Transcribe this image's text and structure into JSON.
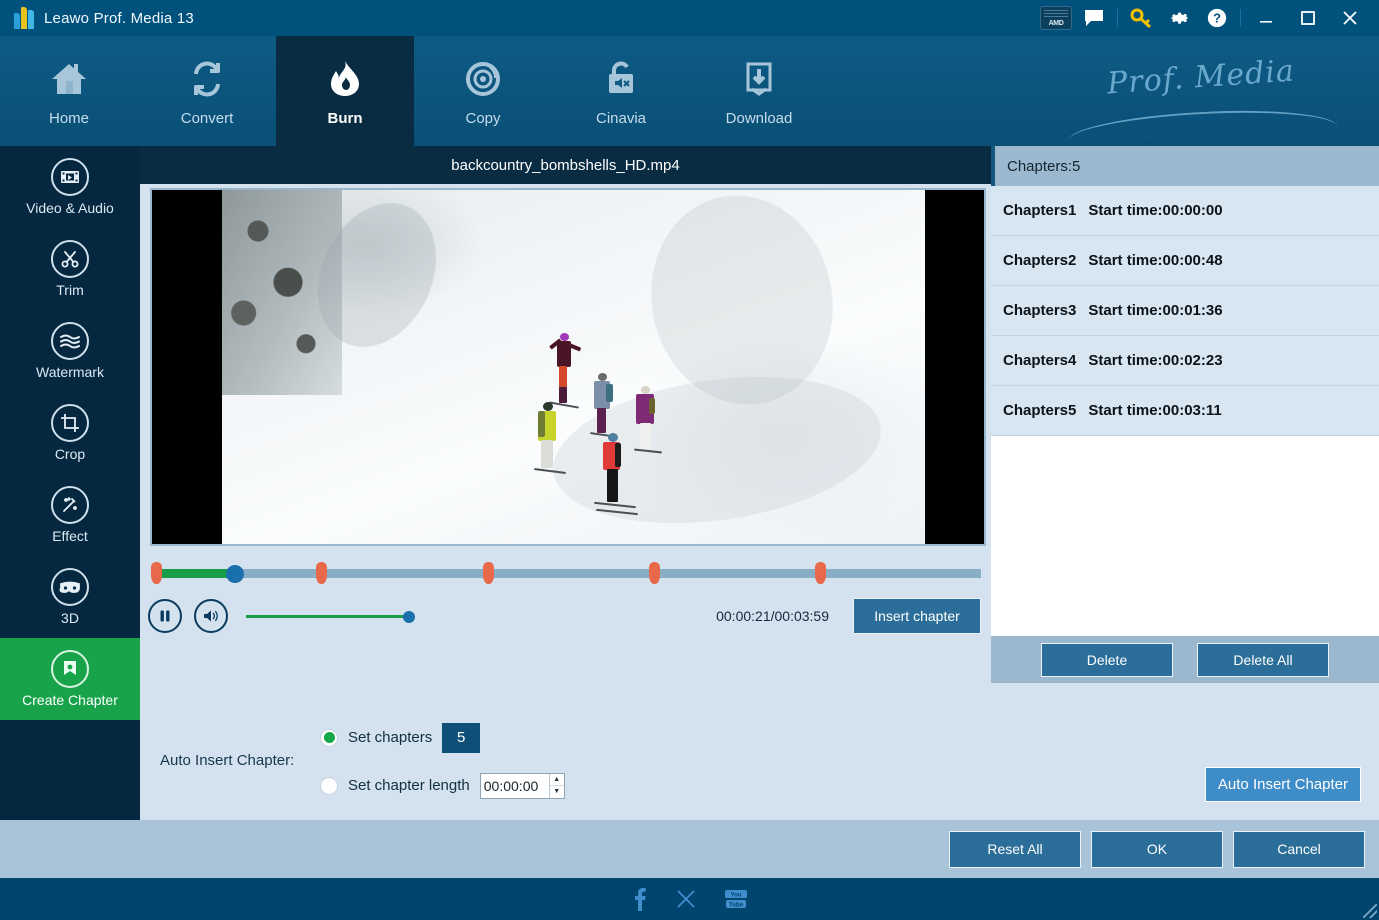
{
  "window": {
    "title": "Leawo Prof. Media 13",
    "icons": {
      "amd": "AMD",
      "feedback": "feedback-icon",
      "key": "key-icon",
      "settings": "gear-icon",
      "help": "help-icon",
      "minimize": "minimize-icon",
      "maximize": "maximize-icon",
      "close": "close-icon"
    }
  },
  "nav": {
    "items": [
      {
        "label": "Home",
        "icon": "home-icon",
        "active": false
      },
      {
        "label": "Convert",
        "icon": "convert-icon",
        "active": false
      },
      {
        "label": "Burn",
        "icon": "flame-icon",
        "active": true
      },
      {
        "label": "Copy",
        "icon": "disc-icon",
        "active": false
      },
      {
        "label": "Cinavia",
        "icon": "mute-lock-icon",
        "active": false
      },
      {
        "label": "Download",
        "icon": "download-icon",
        "active": false
      }
    ],
    "brand": "Prof. Media"
  },
  "sidebar": {
    "items": [
      {
        "label": "Video & Audio",
        "icon": "film-icon",
        "active": false
      },
      {
        "label": "Trim",
        "icon": "scissors-icon",
        "active": false
      },
      {
        "label": "Watermark",
        "icon": "waves-icon",
        "active": false
      },
      {
        "label": "Crop",
        "icon": "crop-icon",
        "active": false
      },
      {
        "label": "Effect",
        "icon": "magic-wand-icon",
        "active": false
      },
      {
        "label": "3D",
        "icon": "glasses-icon",
        "active": false
      },
      {
        "label": "Create Chapter",
        "icon": "chapter-icon",
        "active": true
      }
    ]
  },
  "preview": {
    "file_name": "backcountry_bombshells_HD.mp4"
  },
  "player": {
    "current_time": "00:00:21",
    "total_time": "00:03:59",
    "time_display": "00:00:21/00:03:59",
    "progress_percent": 8.8,
    "volume_percent": 94,
    "play_state": "pause-icon",
    "volume_icon": "volume-on-icon",
    "insert_chapter_label": "Insert chapter",
    "markers_percent": [
      0.5,
      20.0,
      40.2,
      60.3,
      80.4
    ]
  },
  "auto_insert": {
    "section_label": "Auto Insert Chapter:",
    "set_chapters_label": "Set chapters",
    "set_chapters_value": "5",
    "set_chapters_selected": true,
    "set_length_label": "Set chapter length",
    "set_length_value": "00:00:00",
    "set_length_selected": false,
    "button_label": "Auto Insert Chapter"
  },
  "chapters_panel": {
    "header": "Chapters:5",
    "columns": [
      "Chapter",
      "Start time"
    ],
    "rows": [
      {
        "name": "Chapters1",
        "time": "Start time:00:00:00"
      },
      {
        "name": "Chapters2",
        "time": "Start time:00:00:48"
      },
      {
        "name": "Chapters3",
        "time": "Start time:00:01:36"
      },
      {
        "name": "Chapters4",
        "time": "Start time:00:02:23"
      },
      {
        "name": "Chapters5",
        "time": "Start time:00:03:11"
      }
    ],
    "delete_label": "Delete",
    "delete_all_label": "Delete All"
  },
  "bottom_bar": {
    "reset_all": "Reset All",
    "ok": "OK",
    "cancel": "Cancel"
  },
  "footer": {
    "socials": [
      "facebook-icon",
      "x-icon",
      "youtube-icon"
    ]
  },
  "colors": {
    "accent_green": "#18a34a",
    "accent_blue": "#2a6e99",
    "marker_red": "#e8684a",
    "titlebar": "#00527d",
    "panel_bg": "#d3e2ee"
  }
}
